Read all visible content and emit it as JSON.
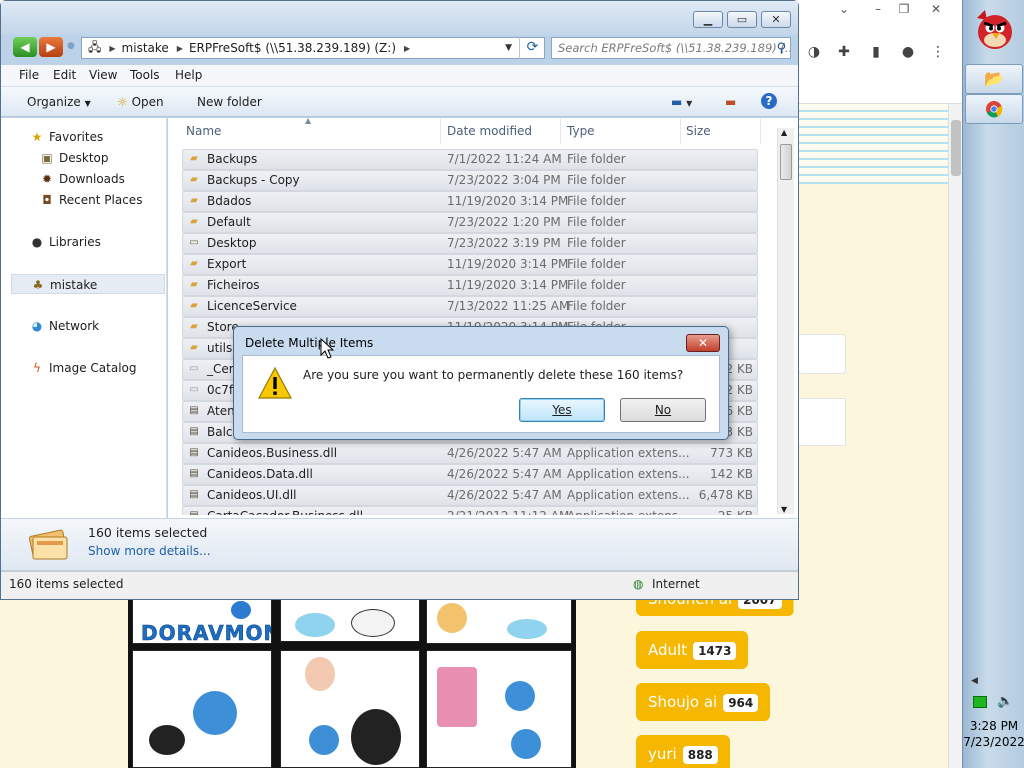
{
  "explorer": {
    "address_segments": [
      "mistake",
      "ERPFreSoft$ (\\\\51.38.239.189) (Z:)"
    ],
    "search_placeholder": "Search ERPFreSoft$ (\\\\51.38.239.189) (...",
    "menu": [
      "File",
      "Edit",
      "View",
      "Tools",
      "Help"
    ],
    "toolbar": {
      "organize": "Organize",
      "open": "Open",
      "new_folder": "New folder"
    },
    "nav": {
      "favorites": "Favorites",
      "desktop": "Desktop",
      "downloads": "Downloads",
      "recent_places": "Recent Places",
      "libraries": "Libraries",
      "mistake": "mistake",
      "network": "Network",
      "image_catalog": "Image Catalog"
    },
    "columns": {
      "name": "Name",
      "date": "Date modified",
      "type": "Type",
      "size": "Size"
    },
    "files": [
      {
        "name": "Backups",
        "date": "7/1/2022 11:24 AM",
        "type": "File folder",
        "size": "",
        "icon": "folder"
      },
      {
        "name": "Backups - Copy",
        "date": "7/23/2022 3:04 PM",
        "type": "File folder",
        "size": "",
        "icon": "folder"
      },
      {
        "name": "Bdados",
        "date": "11/19/2020 3:14 PM",
        "type": "File folder",
        "size": "",
        "icon": "folder"
      },
      {
        "name": "Default",
        "date": "7/23/2022 1:20 PM",
        "type": "File folder",
        "size": "",
        "icon": "folder"
      },
      {
        "name": "Desktop",
        "date": "7/23/2022 3:19 PM",
        "type": "File folder",
        "size": "",
        "icon": "desktop"
      },
      {
        "name": "Export",
        "date": "11/19/2020 3:14 PM",
        "type": "File folder",
        "size": "",
        "icon": "folder"
      },
      {
        "name": "Ficheiros",
        "date": "11/19/2020 3:14 PM",
        "type": "File folder",
        "size": "",
        "icon": "folder"
      },
      {
        "name": "LicenceService",
        "date": "7/13/2022 11:25 AM",
        "type": "File folder",
        "size": "",
        "icon": "folder"
      },
      {
        "name": "Store",
        "date": "11/19/2020 3:14 PM",
        "type": "File folder",
        "size": "",
        "icon": "folder"
      },
      {
        "name": "utils",
        "date": "",
        "type": "",
        "size": "",
        "icon": "folder"
      },
      {
        "name": "_Cem",
        "date": "",
        "type": "",
        "size": "2 KB",
        "icon": "doc"
      },
      {
        "name": "0c7ff",
        "date": "",
        "type": "",
        "size": "2 KB",
        "icon": "doc"
      },
      {
        "name": "Atend",
        "date": "",
        "type": "",
        "size": "6 KB",
        "icon": "dll"
      },
      {
        "name": "Balca",
        "date": "",
        "type": "",
        "size": "3 KB",
        "icon": "dll"
      },
      {
        "name": "Canideos.Business.dll",
        "date": "4/26/2022 5:47 AM",
        "type": "Application extens...",
        "size": "773 KB",
        "icon": "dll"
      },
      {
        "name": "Canideos.Data.dll",
        "date": "4/26/2022 5:47 AM",
        "type": "Application extens...",
        "size": "142 KB",
        "icon": "dll"
      },
      {
        "name": "Canideos.UI.dll",
        "date": "4/26/2022 5:47 AM",
        "type": "Application extens...",
        "size": "6,478 KB",
        "icon": "dll"
      },
      {
        "name": "CartaCacador.Business.dll",
        "date": "2/21/2012 11:12 AM",
        "type": "Application extens...",
        "size": "25 KB",
        "icon": "dll"
      }
    ],
    "details": {
      "selected": "160 items selected",
      "more": "Show more details..."
    },
    "status": {
      "left": "160 items selected",
      "zone": "Internet"
    }
  },
  "dialog": {
    "title": "Delete Multiple Items",
    "message": "Are you sure you want to permanently delete these 160 items?",
    "yes": "Yes",
    "no": "No"
  },
  "background": {
    "logo": "DORAVMON",
    "tags": [
      {
        "label": "Shounen ai",
        "count": "2007"
      },
      {
        "label": "Adult",
        "count": "1473"
      },
      {
        "label": "Shoujo ai",
        "count": "964"
      },
      {
        "label": "yuri",
        "count": "888"
      }
    ]
  },
  "taskbar": {
    "time": "3:28 PM",
    "date": "7/23/2022"
  },
  "colors": {
    "tag": "#f5b700",
    "link": "#1d5fa8",
    "dialog_frame": "#c9dbee"
  }
}
